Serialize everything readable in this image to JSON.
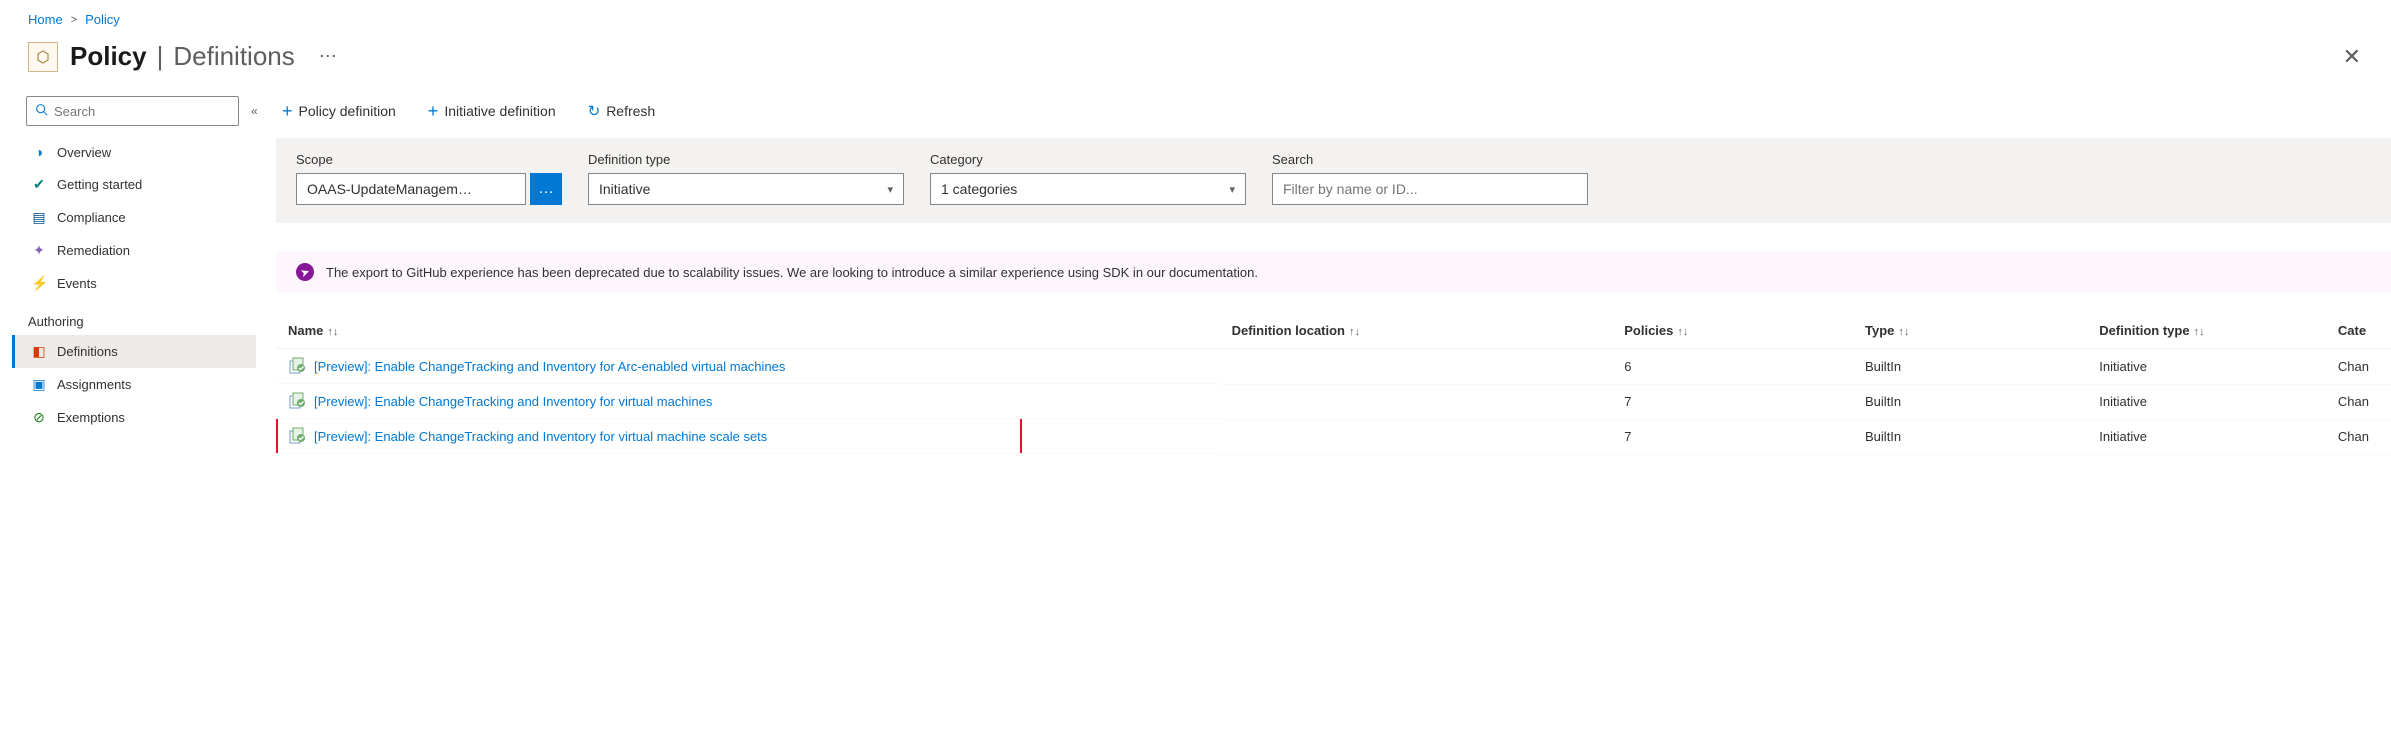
{
  "breadcrumb": {
    "home": "Home",
    "policy": "Policy"
  },
  "title": {
    "main": "Policy",
    "sub": "Definitions"
  },
  "sidebar": {
    "search_placeholder": "Search",
    "items": {
      "overview": "Overview",
      "getting_started": "Getting started",
      "compliance": "Compliance",
      "remediation": "Remediation",
      "events": "Events"
    },
    "section": "Authoring",
    "authoring": {
      "definitions": "Definitions",
      "assignments": "Assignments",
      "exemptions": "Exemptions"
    }
  },
  "toolbar": {
    "policy_def": "Policy definition",
    "initiative_def": "Initiative definition",
    "refresh": "Refresh"
  },
  "filters": {
    "scope_label": "Scope",
    "scope_value": "OAAS-UpdateManagem…",
    "deftype_label": "Definition type",
    "deftype_value": "Initiative",
    "category_label": "Category",
    "category_value": "1 categories",
    "search_label": "Search",
    "search_placeholder": "Filter by name or ID..."
  },
  "banner": "The export to GitHub experience has been deprecated due to scalability issues. We are looking to introduce a similar experience using SDK in our documentation.",
  "table": {
    "headers": {
      "name": "Name",
      "location": "Definition location",
      "policies": "Policies",
      "type": "Type",
      "deftype": "Definition type",
      "category": "Cate"
    },
    "rows": [
      {
        "name": "[Preview]: Enable ChangeTracking and Inventory for Arc-enabled virtual machines",
        "location": "",
        "policies": "6",
        "type": "BuiltIn",
        "deftype": "Initiative",
        "category": "Chan"
      },
      {
        "name": "[Preview]: Enable ChangeTracking and Inventory for virtual machines",
        "location": "",
        "policies": "7",
        "type": "BuiltIn",
        "deftype": "Initiative",
        "category": "Chan"
      },
      {
        "name": "[Preview]: Enable ChangeTracking and Inventory for virtual machine scale sets",
        "location": "",
        "policies": "7",
        "type": "BuiltIn",
        "deftype": "Initiative",
        "category": "Chan"
      }
    ]
  }
}
